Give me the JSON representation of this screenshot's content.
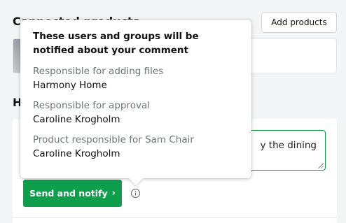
{
  "page": {
    "section_heading": "Connected products",
    "add_products_label": "Add products",
    "history_heading": "History"
  },
  "comment": {
    "value": "y the dining",
    "send_button_label": "Send and notify",
    "send_button_chevron": "›"
  },
  "tooltip": {
    "title": "These users and groups will be notified about your comment",
    "groups": [
      {
        "role": "Responsible for adding files",
        "assignee": "Harmony Home"
      },
      {
        "role": "Responsible for approval",
        "assignee": "Caroline Krogholm"
      },
      {
        "role": "Product responsible for Sam Chair",
        "assignee": "Caroline Krogholm"
      }
    ]
  },
  "colors": {
    "accent_green": "#0e9e4c",
    "focus_border": "#119a48",
    "muted_text": "#6f7478",
    "page_background": "#f3f4f6"
  },
  "icons": {
    "info": "info-circle-icon",
    "chevron": "chevron-right-icon",
    "resize": "resize-grip-icon"
  }
}
